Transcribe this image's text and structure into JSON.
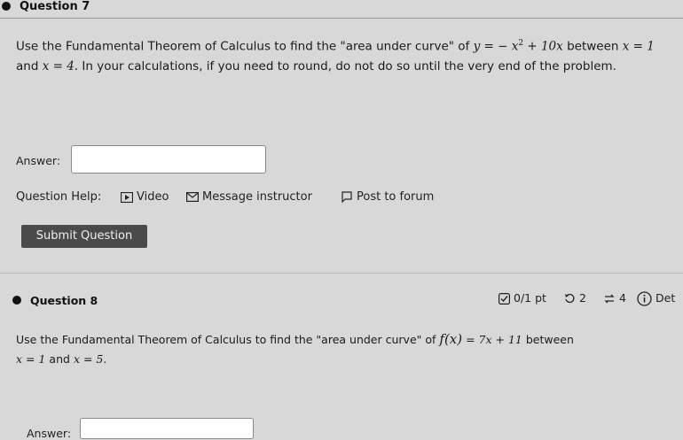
{
  "q7": {
    "title": "Question 7",
    "prompt_pre": "Use the Fundamental Theorem of Calculus to find the \"area under curve\" of",
    "func_var": "y",
    "func_eq": "=",
    "func_rhs_a": "− x",
    "func_rhs_exp": "2",
    "func_rhs_b": " + 10x",
    "prompt_between": "between",
    "bounds_x1": "x = 1",
    "bounds_and": "and",
    "bounds_x2": "x = 4.",
    "prompt_post": "In your calculations, if you need to round, do not do so until the very end of the problem.",
    "answer_label": "Answer:",
    "answer_value": ""
  },
  "help": {
    "label": "Question Help:",
    "video": "Video",
    "message": "Message instructor",
    "forum": "Post to forum"
  },
  "submit_label": "Submit Question",
  "q8": {
    "title": "Question 8",
    "points": "0/1 pt",
    "retries": "2",
    "attempts": "4",
    "details": "Det",
    "prompt_pre": "Use the Fundamental Theorem of Calculus to find the \"area under curve\" of",
    "func": "f(x)",
    "func_eq": "= 7x + 11",
    "prompt_between": "between",
    "bounds_x1": "x = 1",
    "bounds_and": "and",
    "bounds_x2": "x = 5.",
    "answer_label": "Answer:",
    "answer_value": ""
  }
}
